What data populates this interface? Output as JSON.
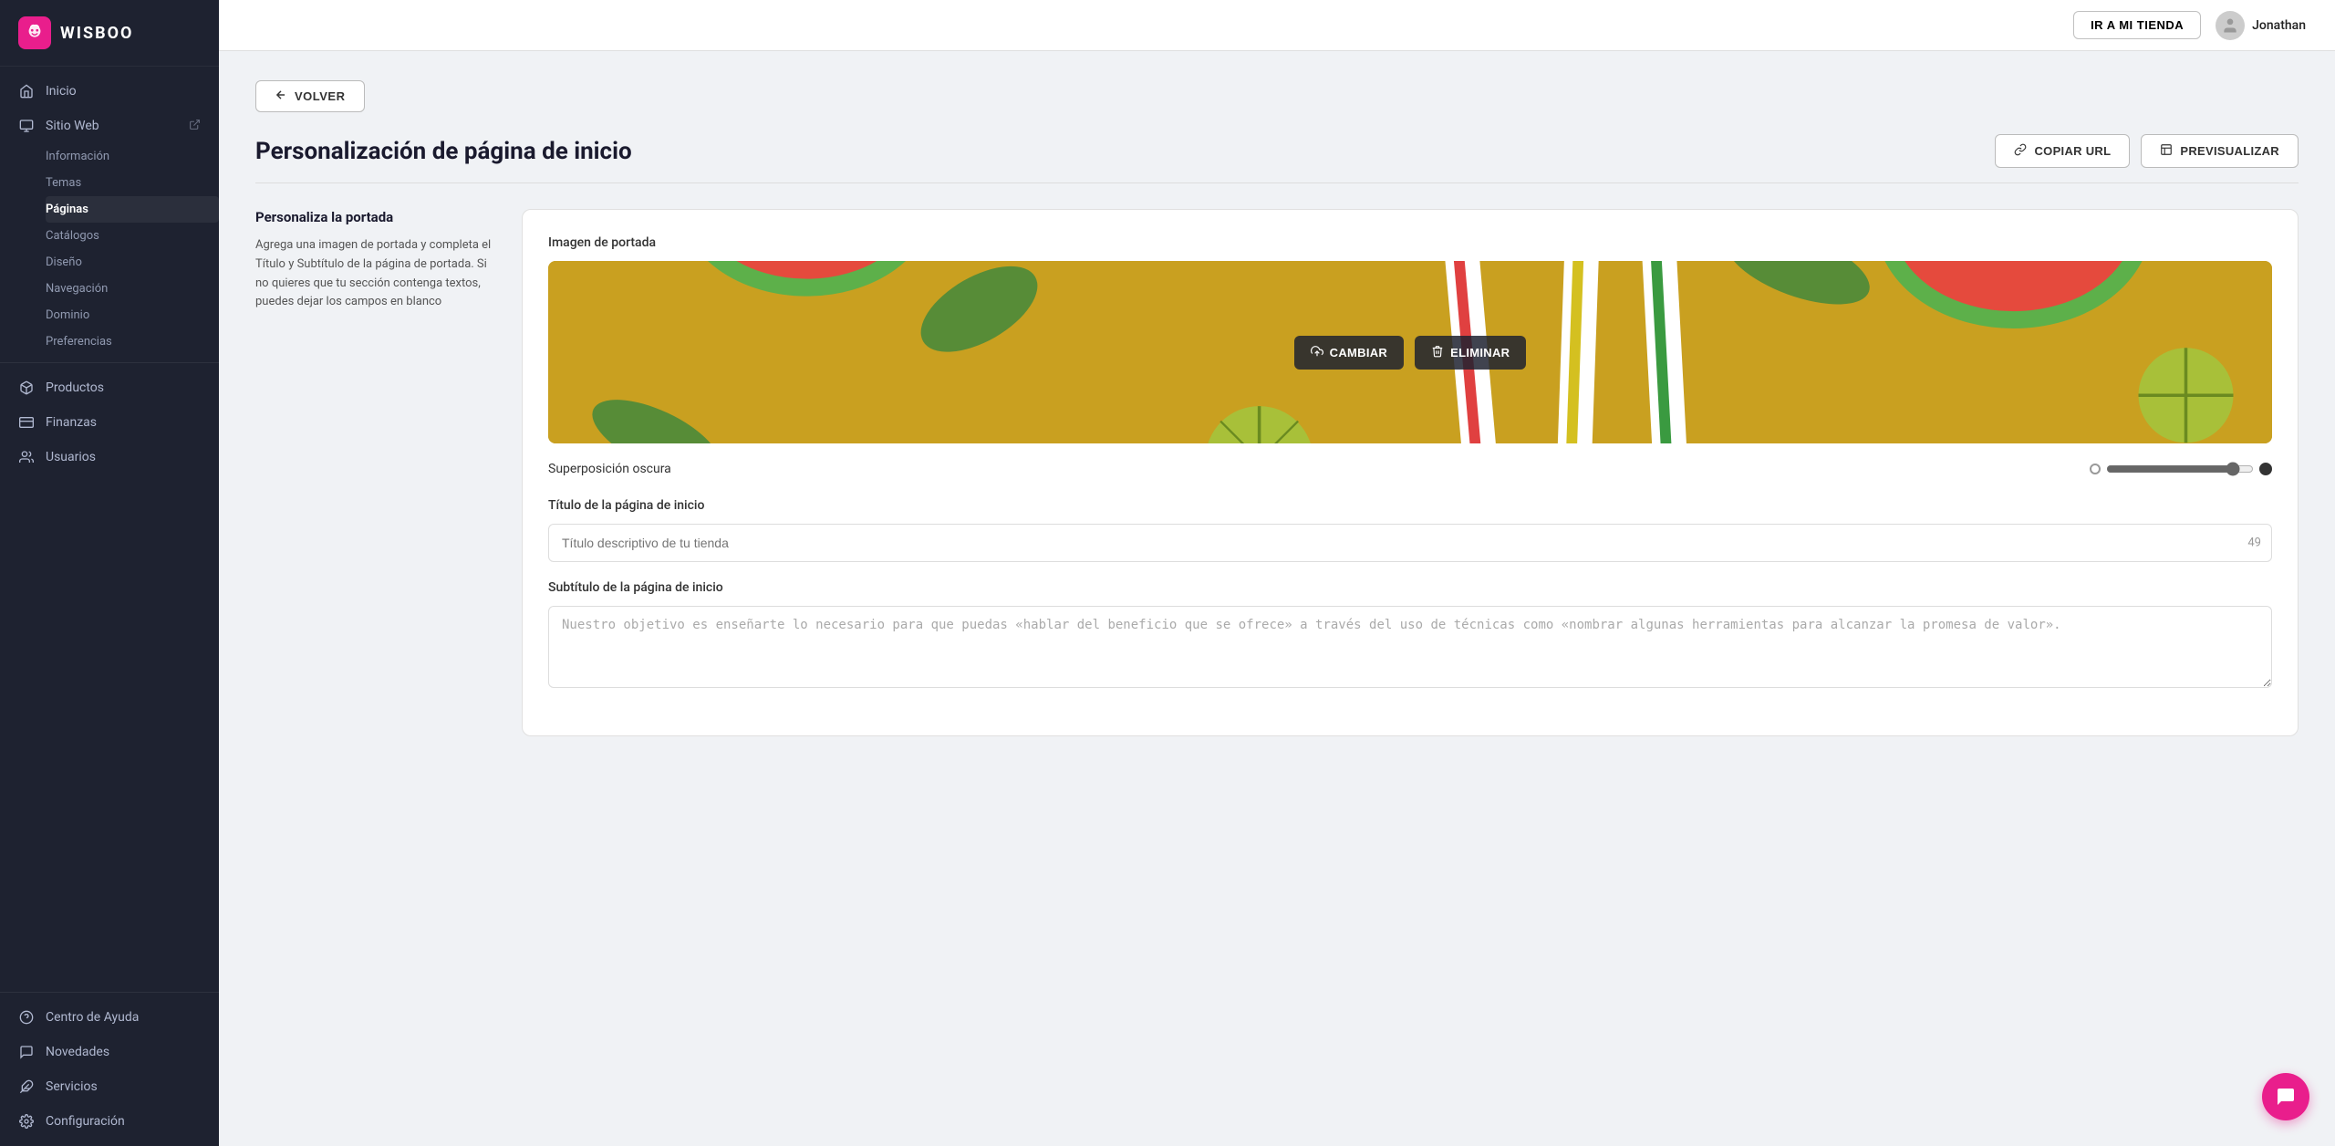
{
  "app": {
    "logo_text": "WISBOO",
    "logo_icon": "🦉"
  },
  "topbar": {
    "store_btn": "IR A MI TIENDA",
    "username": "Jonathan"
  },
  "sidebar": {
    "main_items": [
      {
        "id": "inicio",
        "label": "Inicio",
        "icon": "home"
      },
      {
        "id": "sitio-web",
        "label": "Sitio Web",
        "icon": "monitor",
        "has_external": true
      }
    ],
    "sitio_web_sub": [
      {
        "id": "informacion",
        "label": "Información",
        "active": false
      },
      {
        "id": "temas",
        "label": "Temas",
        "active": false
      },
      {
        "id": "paginas",
        "label": "Páginas",
        "active": true
      },
      {
        "id": "catalogos",
        "label": "Catálogos",
        "active": false
      },
      {
        "id": "diseno",
        "label": "Diseño",
        "active": false
      },
      {
        "id": "navegacion",
        "label": "Navegación",
        "active": false
      },
      {
        "id": "dominio",
        "label": "Dominio",
        "active": false
      },
      {
        "id": "preferencias",
        "label": "Preferencias",
        "active": false
      }
    ],
    "other_items": [
      {
        "id": "productos",
        "label": "Productos",
        "icon": "box"
      },
      {
        "id": "finanzas",
        "label": "Finanzas",
        "icon": "creditcard"
      },
      {
        "id": "usuarios",
        "label": "Usuarios",
        "icon": "users"
      }
    ],
    "bottom_items": [
      {
        "id": "centro-ayuda",
        "label": "Centro de Ayuda",
        "icon": "help"
      },
      {
        "id": "novedades",
        "label": "Novedades",
        "icon": "chat"
      },
      {
        "id": "servicios",
        "label": "Servicios",
        "icon": "puzzle"
      },
      {
        "id": "configuracion",
        "label": "Configuración",
        "icon": "gear"
      }
    ]
  },
  "content": {
    "back_btn": "VOLVER",
    "page_title": "Personalización de página de inicio",
    "actions": {
      "copy_url": "COPIAR URL",
      "preview": "PREVISUALIZAR"
    },
    "section": {
      "desc_title": "Personaliza la portada",
      "desc_text": "Agrega una imagen de portada y completa el Título y Subtítulo de la página de portada. Si no quieres que tu sección contenga textos, puedes dejar los campos en blanco",
      "image_label": "Imagen de portada",
      "change_btn": "CAMBIAR",
      "delete_btn": "ELIMINAR",
      "slider_label": "Superposición oscura",
      "slider_value": 90,
      "title_label": "Título de la página de inicio",
      "title_placeholder": "Título descriptivo de tu tienda",
      "title_count": "49",
      "subtitle_label": "Subtítulo de la página de inicio",
      "subtitle_text": "Nuestro objetivo es enseñarte lo necesario para que puedas «hablar del beneficio que se ofrece» a través del uso de técnicas como «nombrar algunas herramientas para alcanzar la promesa de valor»."
    }
  }
}
